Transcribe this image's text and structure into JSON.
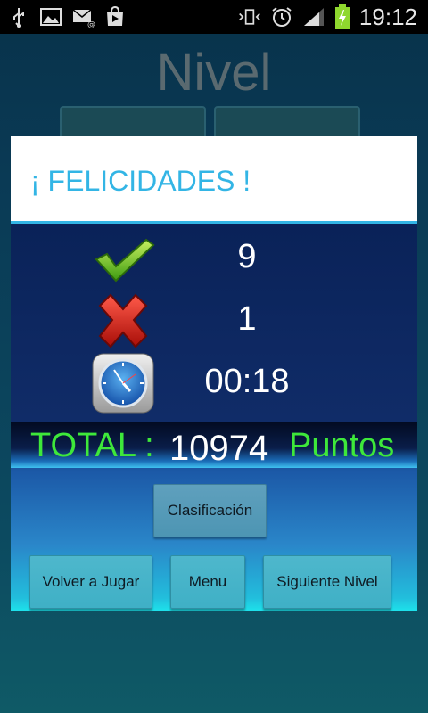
{
  "status_bar": {
    "time": "19:12",
    "left_icons": [
      "usb-icon",
      "image-icon",
      "email-icon",
      "play-store-icon"
    ],
    "right_icons": [
      "vibrate-icon",
      "alarm-icon",
      "signal-icon",
      "battery-charging-icon"
    ]
  },
  "background": {
    "title": "Nivel"
  },
  "dialog": {
    "title": "¡ FELICIDADES !",
    "stats": {
      "correct": {
        "icon": "checkmark-icon",
        "value": "9"
      },
      "wrong": {
        "icon": "cross-icon",
        "value": "1"
      },
      "time": {
        "icon": "clock-icon",
        "value": "00:18"
      }
    },
    "total": {
      "label": "TOTAL :",
      "value": "10974",
      "unit": "Puntos"
    },
    "buttons": {
      "ranking": "Clasificación",
      "play_again": "Volver a Jugar",
      "menu": "Menu",
      "next_level": "Siguiente Nivel"
    }
  },
  "colors": {
    "accent": "#33b5e5",
    "total_green": "#3ee83a"
  }
}
